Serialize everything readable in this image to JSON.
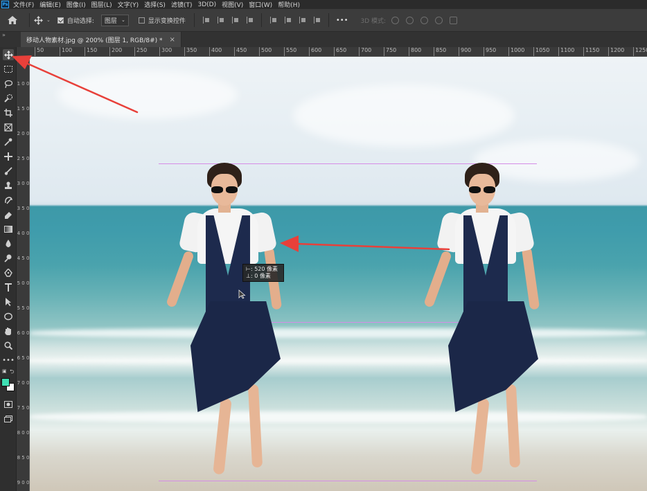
{
  "menubar": {
    "logo": "Ps",
    "items": [
      "文件(F)",
      "编辑(E)",
      "图像(I)",
      "图层(L)",
      "文字(Y)",
      "选择(S)",
      "滤镜(T)",
      "3D(D)",
      "视图(V)",
      "窗口(W)",
      "帮助(H)"
    ]
  },
  "options": {
    "auto_select_label": "自动选择:",
    "auto_select_checked": true,
    "auto_select_target": "图层",
    "show_transform_label": "显示变换控件",
    "show_transform_checked": false,
    "more": "•••",
    "mode_3d": "3D 模式:"
  },
  "tab": {
    "title": "移动人物素材.jpg @ 200% (图层 1, RGB/8#) *",
    "close": "×"
  },
  "ruler": {
    "top_ticks": [
      "50",
      "100",
      "150",
      "200",
      "250",
      "300",
      "350",
      "400",
      "450",
      "500",
      "550",
      "600",
      "650",
      "700",
      "750",
      "800",
      "850",
      "900",
      "950",
      "1000",
      "1050",
      "1100",
      "1150",
      "1200",
      "1250"
    ],
    "left_ticks": [
      "1 0 0",
      "1 5 0",
      "2 0 0",
      "2 5 0",
      "3 0 0",
      "3 5 0",
      "4 0 0",
      "4 5 0",
      "5 0 0",
      "5 5 0",
      "6 0 0",
      "6 5 0",
      "7 0 0",
      "7 5 0",
      "8 0 0",
      "8 5 0",
      "9 0 0"
    ]
  },
  "tooltip": {
    "dx_label": "⊢: 520 像素",
    "dy_label": "⊥:   0 像素"
  },
  "colors": {
    "foreground": "#3fe0b4",
    "background": "#ffffff",
    "guide": "#d58ce6",
    "arrow": "#e8403a"
  },
  "tools": [
    "move-icon",
    "marquee-icon",
    "lasso-icon",
    "quick-select-icon",
    "crop-icon",
    "frame-icon",
    "eyedropper-icon",
    "healing-icon",
    "brush-icon",
    "stamp-icon",
    "history-brush-icon",
    "eraser-icon",
    "gradient-icon",
    "blur-icon",
    "dodge-icon",
    "pen-icon",
    "type-icon",
    "path-select-icon",
    "shape-icon",
    "hand-icon",
    "zoom-icon",
    "more-tools-icon"
  ]
}
